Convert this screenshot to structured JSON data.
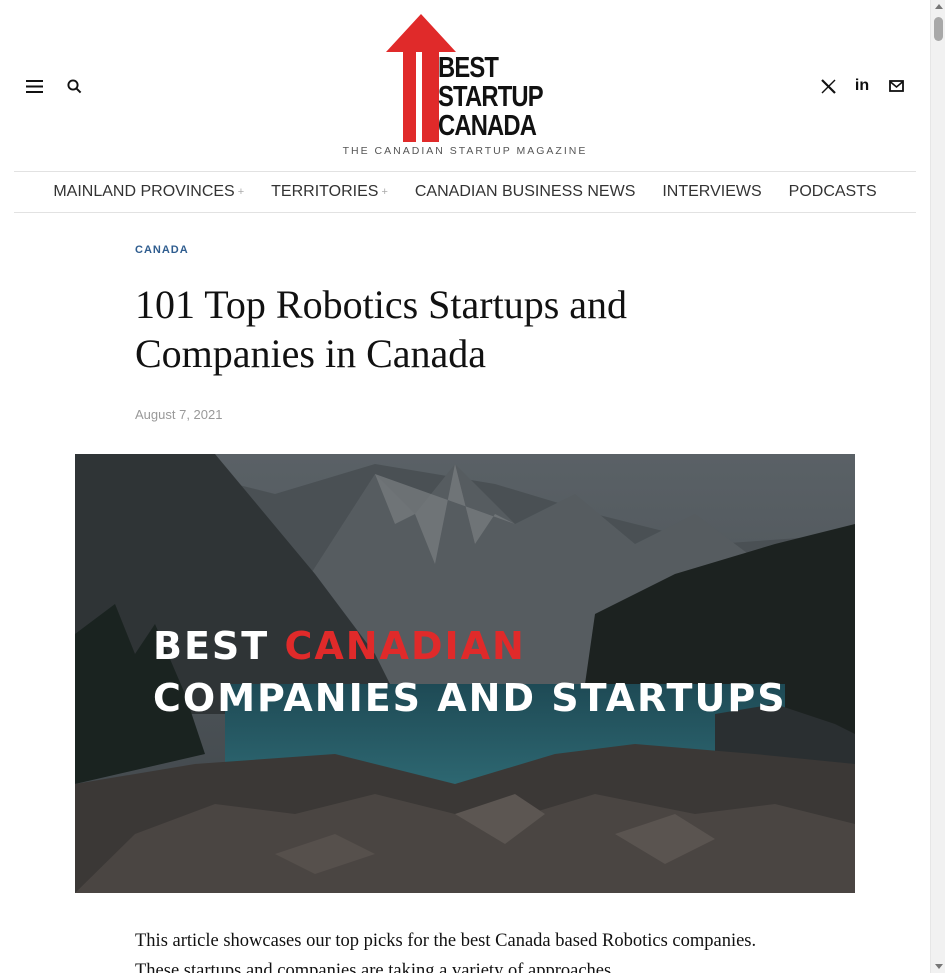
{
  "header": {
    "menu_icon": "hamburger-menu-icon",
    "search_icon": "search-icon",
    "logo_lines": [
      "BEST",
      "STARTUP",
      "CANADA"
    ],
    "tagline": "THE CANADIAN STARTUP MAGAZINE",
    "social": [
      {
        "icon": "x-twitter-icon",
        "label": "𝕏"
      },
      {
        "icon": "linkedin-icon",
        "label": "in"
      },
      {
        "icon": "mail-icon",
        "label": "✉"
      }
    ],
    "brand_color": "#e02a2a"
  },
  "nav": {
    "items": [
      {
        "label": "MAINLAND PROVINCES",
        "submenu": "+"
      },
      {
        "label": "TERRITORIES",
        "submenu": "+"
      },
      {
        "label": "CANADIAN BUSINESS NEWS",
        "submenu": ""
      },
      {
        "label": "INTERVIEWS",
        "submenu": ""
      },
      {
        "label": "PODCASTS",
        "submenu": ""
      }
    ]
  },
  "article": {
    "category": "CANADA",
    "title": "101 Top Robotics Startups and Companies in Canada",
    "date": "August 7, 2021",
    "hero": {
      "line1_prefix": "BEST ",
      "line1_accent": "CANADIAN",
      "line2": "COMPANIES AND STARTUPS",
      "accent_color": "#e02a2a"
    },
    "intro": "This article showcases our top picks for the best Canada based Robotics companies. These startups and companies are taking a variety of approaches"
  }
}
